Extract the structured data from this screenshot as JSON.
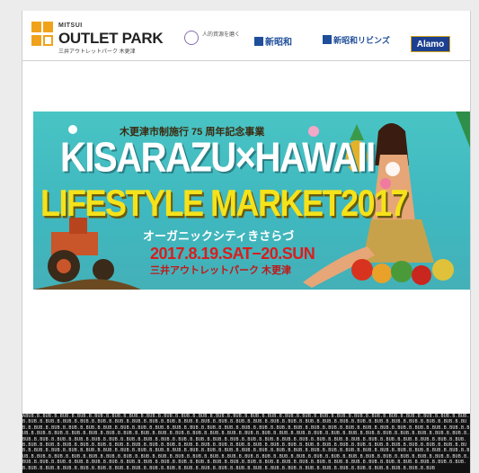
{
  "sponsor_bar": {
    "outlet_brand_top": "MITSUI",
    "outlet_brand_name": "OUTLET PARK",
    "outlet_brand_sub": "三井アウトレットパーク 木更津",
    "sponsor_1": "人的資源を磨く",
    "sponsor_2": "新昭和",
    "sponsor_3": "新昭和リビンズ",
    "sponsor_4": "Alamo"
  },
  "banner": {
    "header": "木更津市制施行 75 周年記念事業",
    "title_line1": "KISARAZU×HAWAII",
    "title_line2": "LIFESTYLE MARKET2017",
    "subtitle": "オーガニックシティきさらづ",
    "date": "2017.8.19.SAT−20.SUN",
    "venue": "三井アウトレットパーク 木更津"
  },
  "footer_pattern": {
    "text": "ABUB.B.BUB.B.BUB.B.BUB.B.BUB.B.BUB.B.BUB.B.BUB.B.BUB.B.BUB.B.BUB.B.BUB.B.BUB.B.BUB.B.BUB.B.BUB.B.BUB.B.BUB.B.BUB.B.BUB.B.BUB.B.BUB.B.BUB.B.BUB.B.BUB.B.BUB.B.BUB.B.BUB.B.BUB.B.BUB.B.BUB.B.BUB.B.BUB.B.BUB.B.BUB.B.BUB.B.BUB.B.BUB.B.BUB.B.BUB.B.BUB.B.BUB.B.BUB.B.BUB.B.BUB.B.BUB.B.BUB.B.BUB.B.BUB.B.BUB.B.BUB.B.BUB.B.BUB.B.BUB.B.BUB.B.BUB.B.BUB.B.BUB.B.BUB.B.BUB.B.BUB.B.BUB.B.BUB.B.BUB.B.BUB.B.BUB.B.BUB.B.BUB.B.BUB.B.BUB.B.BUB.B.BUB.B.BUB.B.BUB.B.BUB.B.BUB.B.BUB.B.BUB.B.BUB.B.BUB.B.BUB.B.BUB.B.BUB.B.BUB.B.BUB.B.BUB.B.BUB.B.BUB.B.BUB.B.BUB.B.BUB.B.BUB.B.BUB.B.BUB.B.BUB.B.BUB.B.BUB.B.BUB.B.BUB.B.BUB.B.BUB.B.BUB.B.BUB.B.BUB.B.BUB.B.BUB.B.BUB.B.BUB.B.BUB.B.BUB.B.BUB.B.BUB.B.BUB.B.BUB.B.BUB.B.BUB.B.BUB.B.BUB.B.BUB.B.BUB.B.BUB.B.BUB.B.BUB.B.BUB.B.BUB.B.BUB.B.BUB.B.BUB.B.BUB.B.BUB.B.BUB.B.BUB.B.BUB.B.BUB.B.BUB.B.BUB.B.BUB.B.BUB.B.BUB.B.BUB.B.BUB.B.BUB.B.BUB.B.BUB.B.BUB.B.BUB.B.BUB.B.BUB.B.BUB.B.BUB.B.BUB.B.BUB.B.BUB.B.BUB.B.BUB.B.BUB.B.BUB.B.BUB.B.BUB.B.BUB.B.BUB.B.BUB.B.BUB.B.BUB.B.BUB.B.BUB.B.BUB.B.BUB.B.BUB.B.BUB.B.BUB.B.BUB.B.BUB.B.BUB.B.BUB.B.BUB.B.BUB.B.BUB.B.BUB.B.BUB.B.BUB.B.BUB.B.BUB.B.BUB.B.BUB.B.BUB.B.BUB.B.BUB.B.BUB.B.BUB.B.BUB.B.BUB.B.BUB.B.BUB.B.BUB.B.BUB.B.BUB.B.BUB.B.BUB.B.BUB.B.BUB.B.BUB.B.BUB.B.BUB.B.BUB.B.BUB.B.BUB.B.BUB.B.BUB.B.BUB.B.BUB.B.BUB.B.BUB.B.BUB.B.BUB.B.BUB.B.BUB.B.BUB.B.BUB.B.BUB.B.BUB.B.BUB.B.BUB.B.BUB.B.BUB.B.BUB.B.BUB.B.BUB.B.BUB.B.BUB.B.BUB.B.BUB.B.BUB.B.BUB.B.BUB.B.BUB.B.BUB.B.BUB.B.BUB.B.BUB.B.BUB.B.BUB.B.BUB.B.BUB.B.BUB.B.BUB.B.BUB.B.BUB.B.BUB.B.BUB.B.BUB.B.BUB.B.BUB.B.BUB.B.BUB.B.BUB"
  },
  "colors": {
    "banner_bg": "#45bcc0",
    "title_white": "#ffffff",
    "title_yellow": "#f5e21a",
    "date_red": "#d81e1e",
    "sponsor_blue": "#1f4e9a",
    "outlet_orange": "#f0a21c"
  }
}
